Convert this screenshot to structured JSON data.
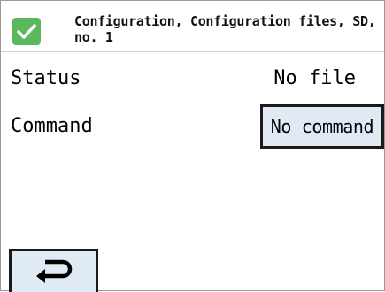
{
  "header": {
    "title": "Configuration, Configuration files, SD, no. 1",
    "status_icon": "checkmark-icon",
    "status_color": "#5cb85c"
  },
  "rows": {
    "status": {
      "label": "Status",
      "value": "No file"
    },
    "command": {
      "label": "Command",
      "value": "No command"
    }
  },
  "footer": {
    "back_icon": "return-arrow-icon"
  },
  "colors": {
    "button_fill": "#dfeaf5",
    "button_border": "#1a1a1a"
  }
}
